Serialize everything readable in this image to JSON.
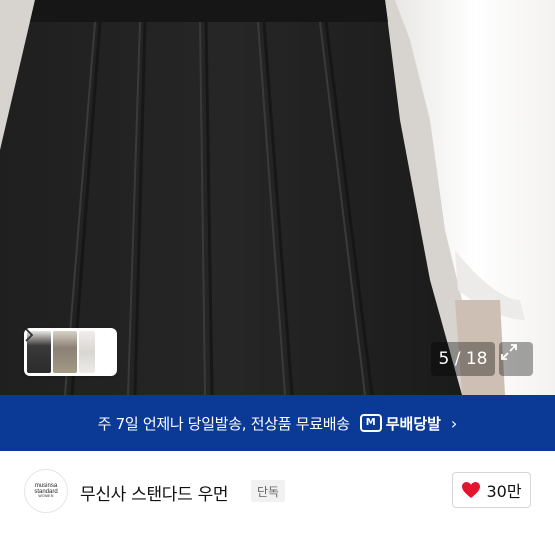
{
  "gallery": {
    "counter": "5 / 18",
    "thumbnail_next_icon": "chevron-right-icon",
    "expand_icon": "expand-arrows-icon"
  },
  "banner": {
    "text": "주 7일 언제나 당일발송, 전상품 무료배송",
    "logo_mark": "M",
    "logo_text": "무배당발",
    "chevron": "›",
    "background_color": "#0b3a96"
  },
  "brand": {
    "logo_line1": "musinsa",
    "logo_line2": "standard",
    "logo_line3": "WOMEN",
    "name": "무신사 스탠다드 우먼",
    "badge": "단독"
  },
  "like": {
    "icon": "heart-icon",
    "count": "30만",
    "heart_color": "#e3152d"
  }
}
